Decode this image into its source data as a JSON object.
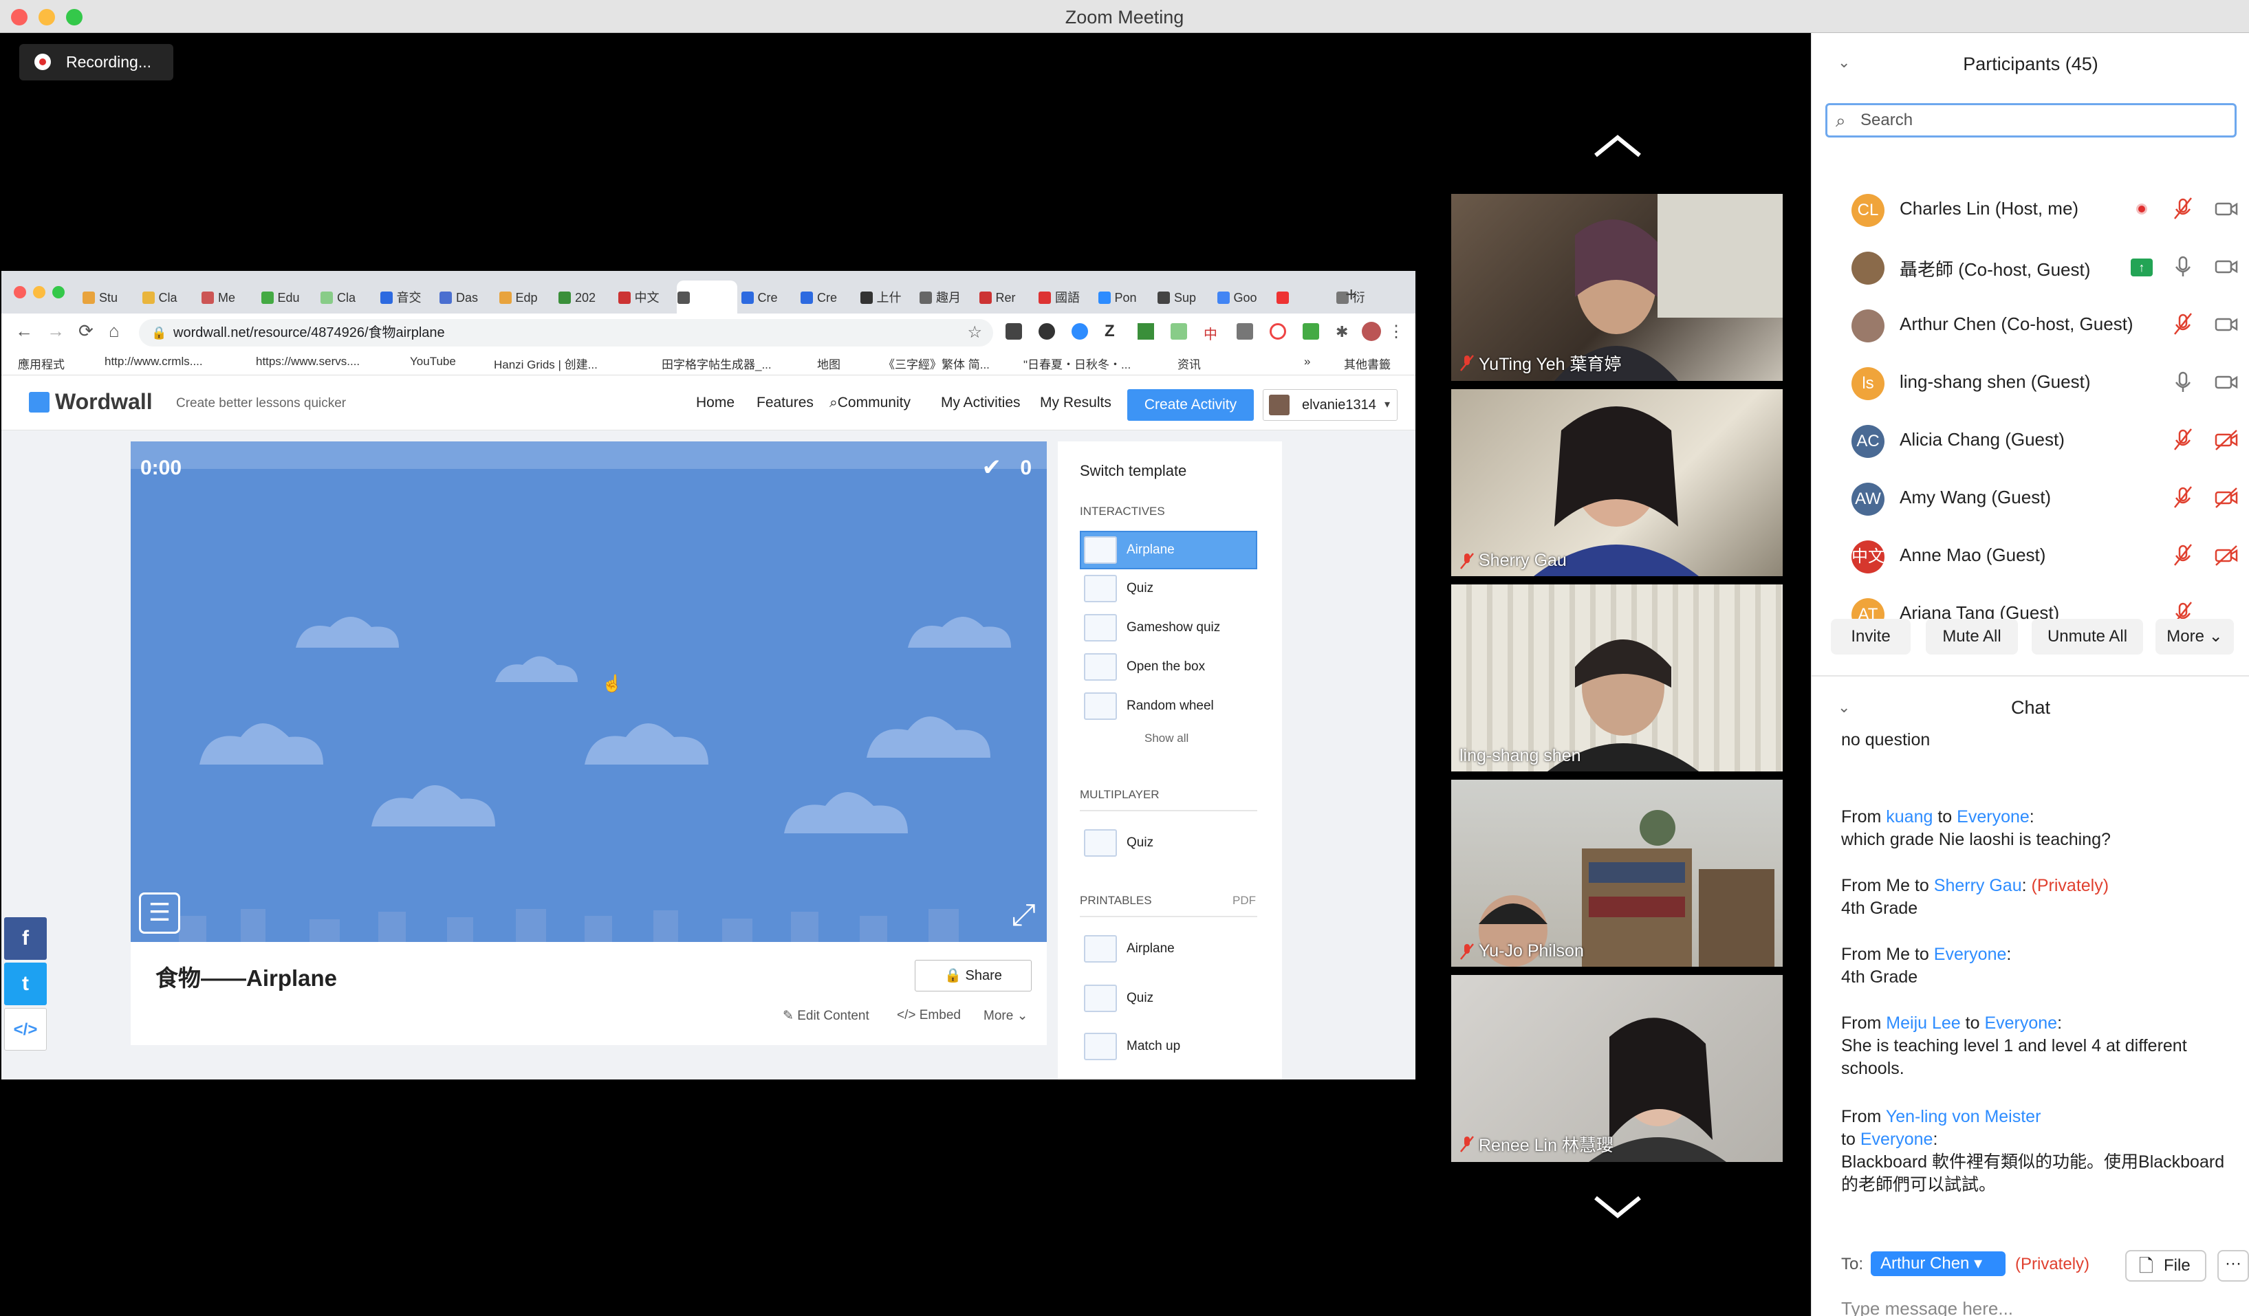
{
  "window": {
    "title": "Zoom Meeting"
  },
  "recording": {
    "label": "Recording..."
  },
  "video_tiles": [
    {
      "name": "YuTing Yeh 葉育婷",
      "muted": true
    },
    {
      "name": "Sherry Gau",
      "muted": true
    },
    {
      "name": "ling-shang shen",
      "muted": false
    },
    {
      "name": "Yu-Jo Philson",
      "muted": true
    },
    {
      "name": "Renee Lin 林慧瓔",
      "muted": true
    }
  ],
  "browser": {
    "tabs": [
      "Stu",
      "Cla",
      "Me",
      "Edu",
      "Cla",
      "音交",
      "Das",
      "Edp",
      "202",
      "中文",
      "",
      "Cre",
      "Cre",
      "上什",
      "趣月",
      "Rer",
      "國語",
      "Pon",
      "Sup",
      "Goo",
      "",
      "衍"
    ],
    "url": "wordwall.net/resource/4874926/食物airplane",
    "bookmarks": [
      "應用程式",
      "http://www.crmls....",
      "https://www.servs....",
      "YouTube",
      "Hanzi Grids | 创建...",
      "田字格字帖生成器_...",
      "地图",
      "《三字經》繁体 简...",
      "\"日春夏・日秋冬・...",
      "资讯",
      "»",
      "其他書籤"
    ]
  },
  "wordwall": {
    "logo": "Wordwall",
    "tagline": "Create better lessons quicker",
    "nav": [
      "Home",
      "Features",
      "Community",
      "My Activities",
      "My Results"
    ],
    "create_label": "Create Activity",
    "username": "elvanie1314",
    "game": {
      "timer": "0:00",
      "score": "0"
    },
    "activity_title": "食物——Airplane",
    "share_label": "Share",
    "actions": [
      "Edit Content",
      "Embed",
      "More"
    ],
    "sidebar": {
      "title": "Switch template",
      "interactives_header": "INTERACTIVES",
      "interactives": [
        "Airplane",
        "Quiz",
        "Gameshow quiz",
        "Open the box",
        "Random wheel"
      ],
      "show_all": "Show all",
      "multiplayer_header": "MULTIPLAYER",
      "multiplayer": [
        "Quiz"
      ],
      "printables_header": "PRINTABLES",
      "pdf_label": "PDF",
      "printables": [
        "Airplane",
        "Quiz",
        "Match up"
      ]
    }
  },
  "participants": {
    "title": "Participants (45)",
    "search_placeholder": "Search",
    "list": [
      {
        "initials": "CL",
        "name": "Charles Lin (Host, me)",
        "color": "#f0a43a"
      },
      {
        "initials": "",
        "name": "聶老師 (Co-host, Guest)",
        "color": "#8a6a4a"
      },
      {
        "initials": "",
        "name": "Arthur Chen (Co-host, Guest)",
        "color": "#9a7a6a"
      },
      {
        "initials": "ls",
        "name": "ling-shang shen (Guest)",
        "color": "#f0a43a"
      },
      {
        "initials": "AC",
        "name": "Alicia Chang (Guest)",
        "color": "#4a6a94"
      },
      {
        "initials": "AW",
        "name": "Amy Wang (Guest)",
        "color": "#4a6a94"
      },
      {
        "initials": "中文",
        "name": "Anne Mao (Guest)",
        "color": "#d6372d"
      },
      {
        "initials": "AT",
        "name": "Ariana Tang (Guest)",
        "color": "#f0a43a"
      }
    ],
    "buttons": [
      "Invite",
      "Mute All",
      "Unmute All",
      "More"
    ]
  },
  "chat": {
    "title": "Chat",
    "partial": "no question",
    "messages": [
      {
        "from": "kuang",
        "to": "Everyone",
        "private": "",
        "text": "which grade Nie laoshi is teaching?"
      },
      {
        "from": "Me",
        "to": "Sherry Gau",
        "private": "(Privately)",
        "text": "4th Grade"
      },
      {
        "from": "Me",
        "to": "Everyone",
        "private": "",
        "text": "4th Grade"
      },
      {
        "from": "Meiju Lee",
        "to": "Everyone",
        "private": "",
        "text": "She is teaching level 1 and level 4 at different schools."
      },
      {
        "from": "Yen-ling von Meister",
        "to": "Everyone",
        "private": "",
        "text": "Blackboard 軟件裡有類似的功能。使用Blackboard 的老師們可以試試。"
      }
    ],
    "from_word": "From",
    "to_word": "to",
    "to_label": "To:",
    "recipient": "Arthur Chen",
    "privately": "(Privately)",
    "file_label": "File",
    "more_label": "···",
    "input_placeholder": "Type message here..."
  },
  "colors": {
    "accent": "#2d8cff",
    "recording": "#e02e2e",
    "game_sky": "#5c8fd6"
  }
}
